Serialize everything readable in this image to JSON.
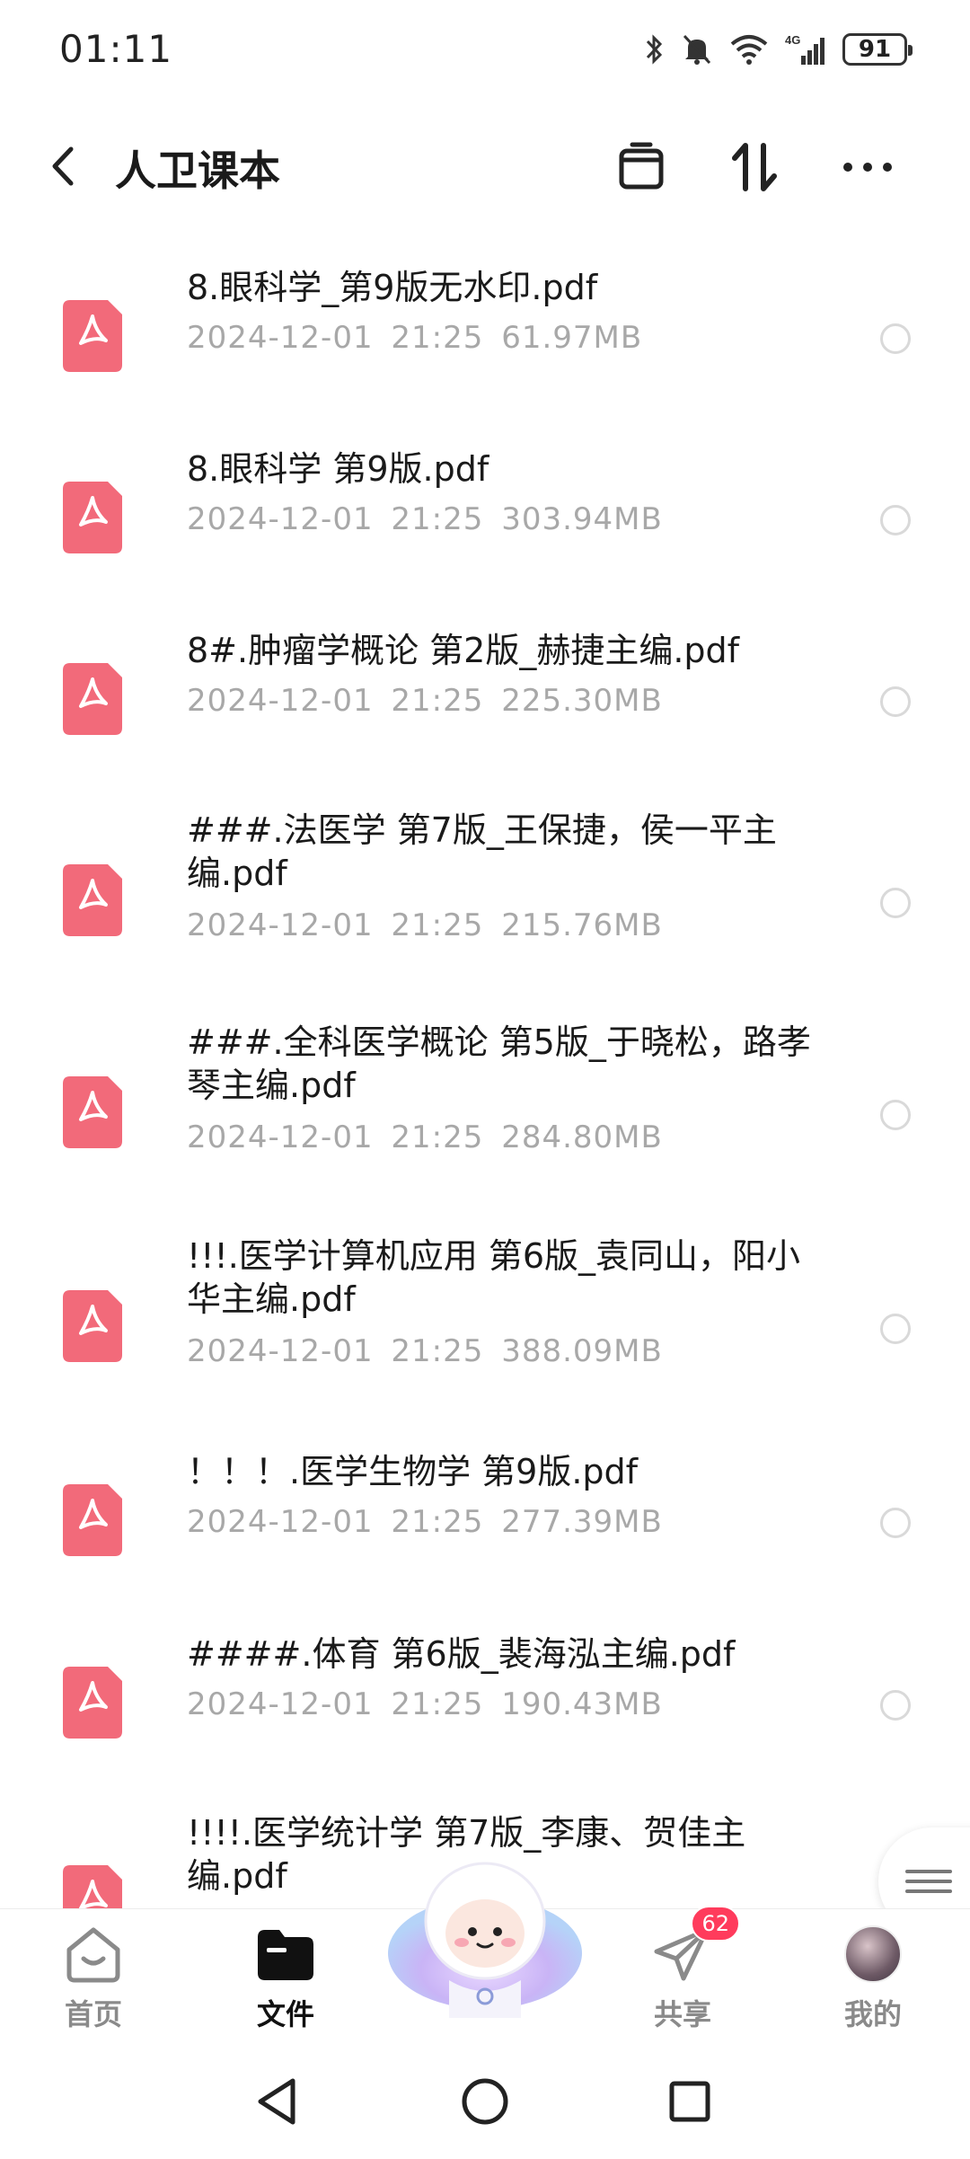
{
  "status_bar": {
    "time": "01:11",
    "network": "4G",
    "battery": "91",
    "icons": [
      "bluetooth-icon",
      "mute-icon",
      "wifi-icon",
      "signal-icon",
      "battery-icon"
    ]
  },
  "header": {
    "title": "人卫课本",
    "icons": [
      "back-icon",
      "archive-icon",
      "sort-icon",
      "more-icon"
    ]
  },
  "files": [
    {
      "name": "8.眼科学_第9版无水印.pdf",
      "date": "2024-12-01",
      "time": "21:25",
      "size": "61.97MB"
    },
    {
      "name": "8.眼科学 第9版.pdf",
      "date": "2024-12-01",
      "time": "21:25",
      "size": "303.94MB"
    },
    {
      "name": "8#.肿瘤学概论 第2版_赫捷主编.pdf",
      "date": "2024-12-01",
      "time": "21:25",
      "size": "225.30MB"
    },
    {
      "name": "###.法医学 第7版_王保捷，侯一平主编.pdf",
      "date": "2024-12-01",
      "time": "21:25",
      "size": "215.76MB"
    },
    {
      "name": "###.全科医学概论 第5版_于晓松，路孝琴主编.pdf",
      "date": "2024-12-01",
      "time": "21:25",
      "size": "284.80MB"
    },
    {
      "name": "!!!.医学计算机应用 第6版_袁同山，阳小华主编.pdf",
      "date": "2024-12-01",
      "time": "21:25",
      "size": "388.09MB"
    },
    {
      "name": "！！！.医学生物学 第9版.pdf",
      "date": "2024-12-01",
      "time": "21:25",
      "size": "277.39MB"
    },
    {
      "name": "####.体育 第6版_裴海泓主编.pdf",
      "date": "2024-12-01",
      "time": "21:25",
      "size": "190.43MB"
    },
    {
      "name": "!!!!.医学统计学 第7版_李康、贺佳主编.pdf",
      "date": "",
      "time": "",
      "size": ""
    }
  ],
  "tabbar": {
    "tabs": [
      {
        "label": "首页",
        "icon": "home-icon"
      },
      {
        "label": "文件",
        "icon": "folder-icon",
        "active": true
      },
      {
        "label": "共享",
        "icon": "send-icon",
        "badge": "62"
      },
      {
        "label": "我的",
        "icon": "avatar"
      }
    ],
    "center_icon": "assistant-mascot-icon"
  },
  "colors": {
    "accent": "#111111",
    "pdf_icon": "#f26a7a",
    "meta_text": "#a8a8a8",
    "badge": "#ff3b5c"
  }
}
